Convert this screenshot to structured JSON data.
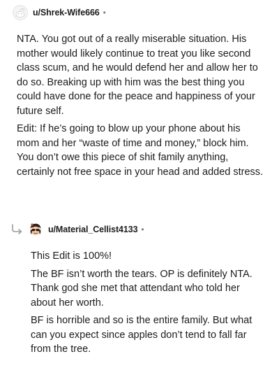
{
  "comments": [
    {
      "username": "u/Shrek-Wife666",
      "separator": "•",
      "avatar_icon": "default-reddit-avatar-icon",
      "paragraphs": [
        "NTA. You got out of a really miserable situation. His mother would likely continue to treat you like second class scum, and he would defend her and allow her to do so. Breaking up with him was the best thing you could have done for the peace and happiness of your future self.",
        "Edit: If he’s going to blow up your phone about his mom and her “waste of time and money,” block him. You don’t owe this piece of shit family anything, certainly not free space in your head and added stress."
      ]
    },
    {
      "username": "u/Material_Cellist4133",
      "separator": "•",
      "avatar_icon": "sunglasses-snoo-avatar-icon",
      "reply_icon": "reply-arrow-icon",
      "paragraphs": [
        "This Edit is 100%!",
        "The BF isn’t worth the tears. OP is definitely NTA. Thank god she met that attendant who told her about her worth.",
        "BF is horrible and so is the entire family. But what can you expect since apples don’t tend to fall far from the tree."
      ]
    }
  ]
}
